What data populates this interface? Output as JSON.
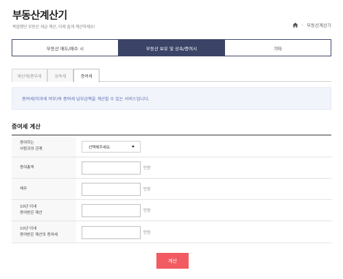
{
  "header": {
    "title": "부동산계산기",
    "subtitle": "복잡했던 부동산 세금 계산, 이제 쉽게 계산하세요!",
    "breadcrumb": [
      "부동산계산기"
    ]
  },
  "main_tabs": [
    {
      "label": "부동산 매도/매수 시",
      "active": false
    },
    {
      "label": "부동산 보유 및 상속/증여시",
      "active": true
    },
    {
      "label": "기타",
      "active": false
    }
  ],
  "sub_tabs": [
    {
      "label": "재산세/종부세",
      "active": false
    },
    {
      "label": "상속세",
      "active": false
    },
    {
      "label": "증여세",
      "active": true
    }
  ],
  "info_text": "증여세(미과세 여부)와 증여세 납부금액을 계산할 수 있는 서비스입니다.",
  "section_title": "증여세 계산",
  "form": {
    "rows": [
      {
        "label_lines": [
          "증여하는",
          "사람과의 관계"
        ],
        "type": "select",
        "value": "선택해주세요."
      },
      {
        "label_lines": [
          "증여총액"
        ],
        "type": "input",
        "value": "",
        "unit": "만원"
      },
      {
        "label_lines": [
          "채무"
        ],
        "type": "input",
        "value": "",
        "unit": "만원"
      },
      {
        "label_lines": [
          "10년 이내",
          "증여받은 재산"
        ],
        "type": "input",
        "value": "",
        "unit": "만원"
      },
      {
        "label_lines": [
          "10년 이내",
          "증여받은 재산의 증여세"
        ],
        "type": "input",
        "value": "",
        "unit": "만원"
      }
    ]
  },
  "calc_button": "계산",
  "colors": {
    "navy": "#3b4467",
    "accent": "#f25b61",
    "info_text": "#5a6cb0"
  }
}
